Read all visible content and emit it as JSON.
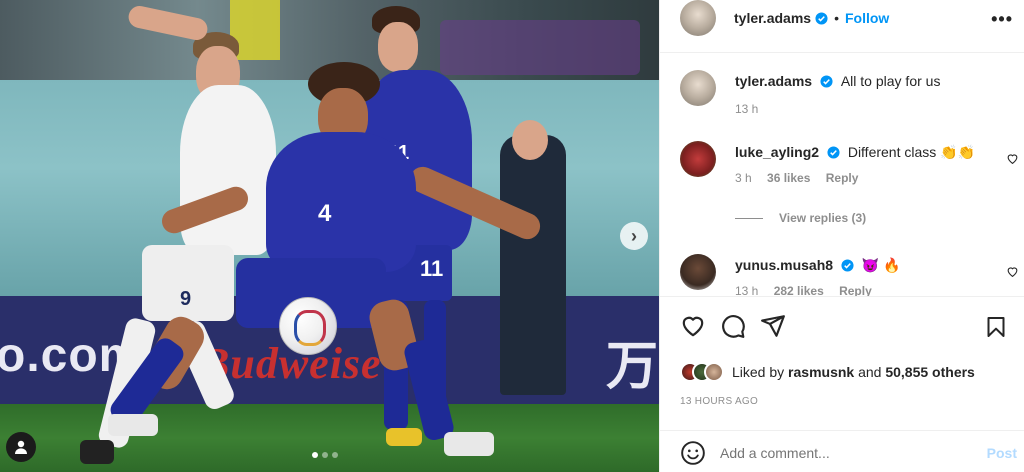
{
  "post": {
    "author": "tyler.adams",
    "follow_label": "Follow",
    "more_icon": "more-horizontal-icon"
  },
  "caption": {
    "username": "tyler.adams",
    "text": "All to play for us",
    "time": "13 h"
  },
  "comments": [
    {
      "username": "luke_ayling2",
      "text": "Different class 👏👏",
      "time": "3 h",
      "likes": "36 likes",
      "reply_label": "Reply",
      "view_replies": "View replies (3)"
    },
    {
      "username": "yunus.musah8",
      "text": "😈 🔥",
      "time": "13 h",
      "likes": "282 likes",
      "reply_label": "Reply"
    }
  ],
  "photo": {
    "ad_left": "o.com",
    "ad_mid": "Budweise",
    "ad_right": "万",
    "number_front": "4",
    "number_back": "11",
    "number_shorts_back": "11",
    "number_england": "9",
    "carousel_next": "›",
    "carousel_count": 3,
    "carousel_active": 1
  },
  "footer": {
    "liked_by_prefix": "Liked by",
    "liked_by_user": "rasmusnk",
    "liked_by_and": "and",
    "liked_by_others": "50,855 others",
    "timestamp": "13 HOURS AGO",
    "add_comment_placeholder": "Add a comment...",
    "post_label": "Post"
  },
  "colors": {
    "accent": "#0095f6",
    "text": "#262626",
    "muted": "#8e8e8e"
  }
}
